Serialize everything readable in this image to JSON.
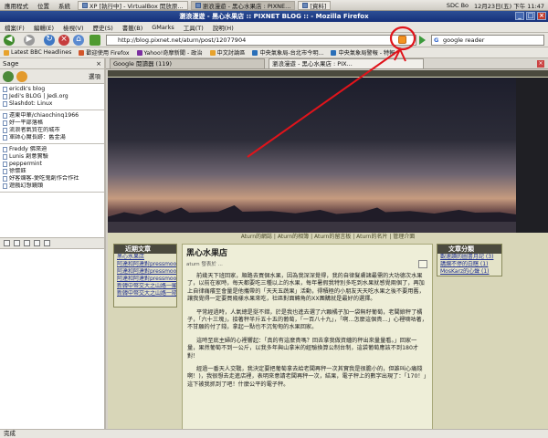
{
  "panel": {
    "menus": [
      "應用程式",
      "位置",
      "系統"
    ],
    "tasks": [
      {
        "label": "XP [執行中] - VirtualBox 開放原..."
      },
      {
        "label": "瀏浪漫遊 - 黑心水果店 : PIXNE..."
      },
      {
        "label": "[資料]"
      }
    ],
    "input_method": "SDC Bo",
    "datetime": "12月23日(五) 下午 11:47"
  },
  "window": {
    "title": "瀏浪漫遊 - 黑心水果店 :: PIXNET BLOG :: - Mozilla Firefox"
  },
  "menubar": {
    "items": [
      "檔案(F)",
      "編輯(E)",
      "檢視(V)",
      "歷史(S)",
      "書籤(B)",
      "GMarks",
      "工具(T)",
      "說明(H)"
    ]
  },
  "navbar": {
    "url": "http://blog.pixnet.net/aturn/post/12077904",
    "search_value": "google reader",
    "search_engine_icon": "G"
  },
  "bookmarks": {
    "items": [
      {
        "label": "Latest BBC Headlines"
      },
      {
        "label": "歡迎使用 Firefox"
      },
      {
        "label": "Yahoo!奇摩新聞 - 政治"
      },
      {
        "label": "中文討論區"
      },
      {
        "label": "中央氣象局-台北市今明..."
      },
      {
        "label": "中央氣象局警報 - 特報"
      }
    ]
  },
  "tabs": {
    "items": [
      {
        "label": "Google 閱讀器 (119)",
        "active": false
      },
      {
        "label": "瀏浪漫遊 - 黑心水果店 : PIX...",
        "active": true
      }
    ]
  },
  "sidebar": {
    "title": "Sage",
    "options_label": "選項",
    "feed_groups": [
      [
        "ericdk's blog",
        "Jedi's BLOG | Jedi.org",
        "Slashdot: Linux"
      ],
      [
        "遠東中華/chiaochinq1966",
        "好一平部落格",
        "流浪者氣質在的城市",
        "軍師心魔長跡：舊金湯"
      ],
      [
        "Freddy 佛來迪",
        "Lunis 創意實驗",
        "peppermint",
        "徐懷鈺",
        "好客爛客-愛吃鬼創作合作社",
        "遊戲幻想鏡頭"
      ]
    ]
  },
  "blog": {
    "nav_links": "Aturn的網誌 | Aturn的相簿 | Aturn的留言板 | Aturn的名片 | 管理介面",
    "left_heading": "近期文章",
    "left_items": [
      "黑心水果店",
      "阿達和阿達對pressmoo - 落葉",
      "阿達和阿達對pressmoo - 第二篇",
      "阿達和阿達對pressmoo - Discovery",
      "新韓中幣交大之山路一顯晴",
      "新韓中幣交大之山路一隨園"
    ],
    "right_heading": "文章分類",
    "right_items": [
      "觀速讀的圖書月記 (3)",
      "講爛不停的白瞎 (1)",
      "MosKarz的心聲 (1)"
    ],
    "post_title": "黑心水果店",
    "post_meta": "aturn 發表於 ...",
    "paragraphs": [
      "前幾天下班回家，順路去買個水果，因為我深深覺得，我的自律髮膚諸最需的大功德次水果了，以前在家時，每天都要吃三種以上的水果，每年暑假我特別多吃到水果就感覺兩個了，再加上自律痛癢至會量是他攜帶的「天天五蔬果」活動，得積極的小朋友天天吃水果之後不要用舊，讓我覺得一定要買幾樣水果來吃，社區對面轉角的XX團購就是最好的選擇。",
      "平常經過時，人氣總是挺不錯，於是我也進去選了六顆橘子加一袋無籽葡萄，老闆娘秤了橘子，「六十三塊」，接著秤半斤五十五的葡萄，「一百八十九」，「啊…怎麼這個貴…」心裡嘀咕著，不甘願的付了錢，拿起一點也不沉甸甸的水果回家。",
      "這時至底主婦的心裡響起：「真的有這麼貴嗎？回去拿我做資纏的秤出來量量看。」回家一量，果然葡萄不到一公斤，以我多年與山拿米的經驗換算公制台制，這袋葡萄應該不到180才對！",
      "經過一番天人交戰，我決定要把葡萄拿去給老闆再秤一次其實我是很膽小的，但誰叫心痛錢啊！)，我很想去走進店裡，表明來意請老闆再秤一次，結果，電子秤上的數字出現了：「170！」這下被我抓到了吧！什麼公平的電子秤。"
    ]
  },
  "annotation": {
    "color": "#e0141b"
  },
  "statusbar": {
    "text": "完成"
  }
}
